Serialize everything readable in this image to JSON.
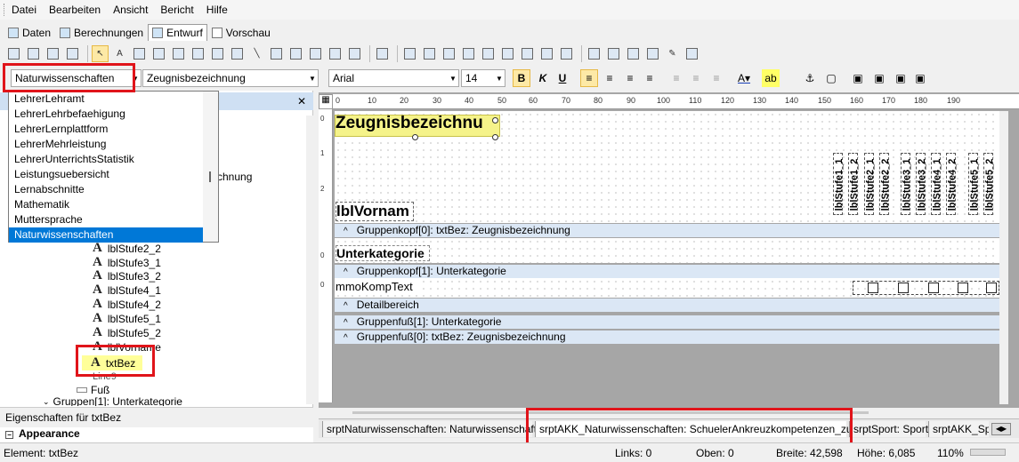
{
  "menu": [
    "Datei",
    "Bearbeiten",
    "Ansicht",
    "Bericht",
    "Hilfe"
  ],
  "viewtabs": [
    "Daten",
    "Berechnungen",
    "Entwurf",
    "Vorschau"
  ],
  "format": {
    "report_combo": "Naturwissenschaften",
    "field_combo": "Zeugnisbezeichnung",
    "font": "Arial",
    "size": "14",
    "bold": "B",
    "italic": "K",
    "underline": "U"
  },
  "dropdown": [
    "LehrerLehramt",
    "LehrerLehrbefaehigung",
    "LehrerLernplattform",
    "LehrerMehrleistung",
    "LehrerUnterrichtsStatistik",
    "Leistungsuebersicht",
    "Lernabschnitte",
    "Mathematik",
    "Muttersprache",
    "Naturwissenschaften"
  ],
  "tree": {
    "behind_text": "chnung",
    "items": [
      "lblStufe2_2",
      "lblStufe3_1",
      "lblStufe3_2",
      "lblStufe4_1",
      "lblStufe4_2",
      "lblStufe5_1",
      "lblStufe5_2"
    ],
    "hidden1": "lblVorname",
    "selected": "txtBez",
    "hidden2": "Line9",
    "footer": "Fuß",
    "group1": "Gruppen[1]: Unterkategorie"
  },
  "props": {
    "title": "Eigenschaften für txtBez",
    "category": "Appearance"
  },
  "ruler": [
    "0",
    "10",
    "20",
    "30",
    "40",
    "50",
    "60",
    "70",
    "80",
    "90",
    "100",
    "110",
    "120",
    "130",
    "140",
    "150",
    "160",
    "170",
    "180",
    "190"
  ],
  "vruler": [
    "0",
    "1",
    "2",
    "0",
    "0"
  ],
  "report": {
    "title": "Zeugnisbezeichnu",
    "vorname": "lblVornam",
    "unterkategorie": "Unterkategorie",
    "komptext": "mmoKompText",
    "stufen": [
      "lblStufe1_1",
      "lblStufe1_2",
      "lblStufe2_1",
      "lblStufe2_2",
      "lblStufe3_1",
      "lblStufe3_2",
      "lblStufe4_1",
      "lblStufe4_2",
      "lblStufe5_1",
      "lblStufe5_2"
    ],
    "bands": [
      "Gruppenkopf[0]: txtBez: Zeugnisbezeichnung",
      "Gruppenkopf[1]: Unterkategorie",
      "Detailbereich",
      "Gruppenfuß[1]: Unterkategorie",
      "Gruppenfuß[0]: txtBez: Zeugnisbezeichnung"
    ]
  },
  "bottomtabs": [
    "srptNaturwissenschaften: Naturwissenschaften",
    "srptAKK_Naturwissenschaften: SchuelerAnkreuzkompetenzen_zu_Fach",
    "srptSport: Sport",
    "srptAKK_Spor"
  ],
  "status": {
    "element": "Element: txtBez",
    "links": "Links: 0",
    "oben": "Oben: 0",
    "breite": "Breite: 42,598",
    "hoehe": "Höhe: 6,085",
    "zoom": "110%"
  }
}
